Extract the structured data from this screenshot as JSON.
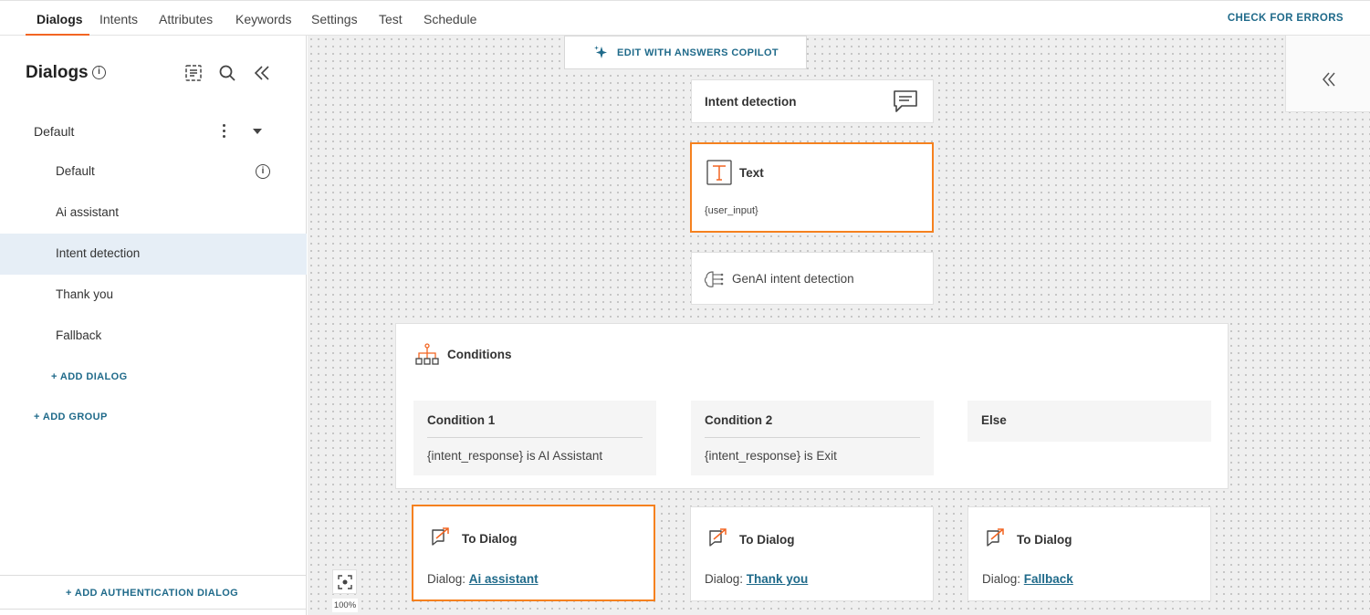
{
  "nav": {
    "tabs": [
      "Dialogs",
      "Intents",
      "Attributes",
      "Keywords",
      "Settings",
      "Test",
      "Schedule"
    ],
    "check_errors": "CHECK FOR ERRORS"
  },
  "sidebar": {
    "title": "Dialogs",
    "info_glyph": "i",
    "group": {
      "label": "Default"
    },
    "items": [
      {
        "label": "Default"
      },
      {
        "label": "Ai assistant"
      },
      {
        "label": "Intent detection"
      },
      {
        "label": "Thank you"
      },
      {
        "label": "Fallback"
      }
    ],
    "add_dialog": "+ ADD DIALOG",
    "add_group": "+ ADD GROUP",
    "add_auth_dialog": "+ ADD AUTHENTICATION DIALOG"
  },
  "canvas": {
    "copilot": "EDIT WITH ANSWERS COPILOT",
    "intent_detection": {
      "title": "Intent detection"
    },
    "text_card": {
      "title": "Text",
      "content": "{user_input}"
    },
    "genai_card": {
      "title": "GenAI intent detection"
    },
    "conditions": {
      "title": "Conditions",
      "items": [
        {
          "title": "Condition 1",
          "rule": "{intent_response} is AI Assistant"
        },
        {
          "title": "Condition 2",
          "rule": "{intent_response} is Exit"
        },
        {
          "title": "Else"
        }
      ]
    },
    "to_dialogs": [
      {
        "title": "To Dialog",
        "prefix": "Dialog: ",
        "target": "Ai assistant"
      },
      {
        "title": "To Dialog",
        "prefix": "Dialog: ",
        "target": "Thank you"
      },
      {
        "title": "To Dialog",
        "prefix": "Dialog: ",
        "target": "Fallback"
      }
    ],
    "zoom": "100%"
  },
  "colors": {
    "accent_orange": "#f5811f",
    "link_blue": "#1f6a8a",
    "selected_bg": "#e6eef6"
  }
}
